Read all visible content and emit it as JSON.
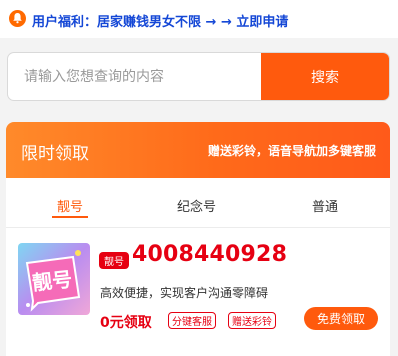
{
  "notice": {
    "icon": "bell-icon",
    "text": "用户福利：居家赚钱男女不限 → → 立即申请",
    "color": "#1447d6"
  },
  "search": {
    "placeholder": "请输入您想查询的内容",
    "button_label": "搜索"
  },
  "card": {
    "title": "限时领取",
    "promo": "赠送彩铃，语音导航加多键客服",
    "tabs": [
      {
        "label": "靓号",
        "active": true
      },
      {
        "label": "纪念号",
        "active": false
      },
      {
        "label": "普通",
        "active": false
      }
    ],
    "item": {
      "image_text": "靓号",
      "badge": "靓号",
      "number": "4008440928",
      "description": "高效便捷，实现客户沟通零障碍",
      "price": "0元领取",
      "tags": [
        "分键客服",
        "赠送彩铃"
      ],
      "button_label": "免费领取"
    }
  },
  "colors": {
    "accent": "#ff5a0d",
    "number": "#e60012"
  }
}
